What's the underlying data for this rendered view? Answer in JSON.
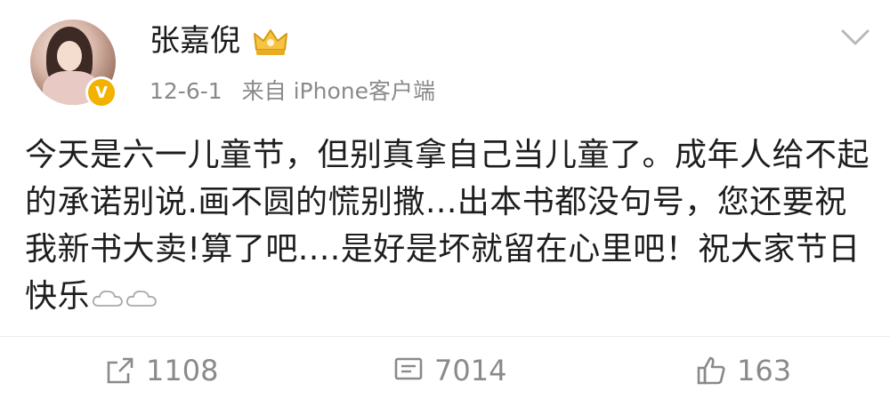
{
  "post": {
    "author": {
      "name": "张嘉倪",
      "badge_icon": "crown-icon",
      "verified_icon": "verified-v-icon",
      "verified_label": "V"
    },
    "meta": {
      "date": "12-6-1",
      "source": "来自 iPhone客户端"
    },
    "menu_icon": "chevron-down-icon",
    "text": "今天是六一儿童节，但别真拿自己当儿童了。成年人给不起的承诺别说.画不圆的慌别撒...出本书都没句号，您还要祝我新书大卖!算了吧....是好是坏就留在心里吧！祝大家节日快乐",
    "emoji_icons": [
      "cloud-emoji-icon",
      "cloud-emoji-icon"
    ],
    "actions": {
      "repost": {
        "icon": "repost-icon",
        "count": "1108"
      },
      "comment": {
        "icon": "comment-icon",
        "count": "7014"
      },
      "like": {
        "icon": "thumbs-up-icon",
        "count": "163"
      }
    }
  },
  "colors": {
    "meta_gray": "#8a8a8a",
    "text": "#1e1e1e",
    "verified_gold": "#f3b100"
  }
}
